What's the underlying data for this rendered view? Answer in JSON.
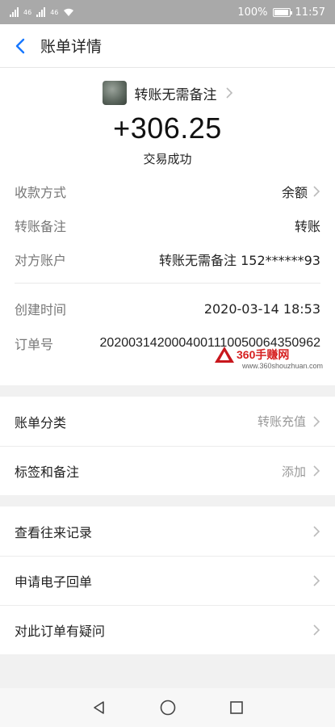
{
  "status": {
    "signal_left": "46",
    "signal_right": "46",
    "battery": "100%",
    "time": "11:57"
  },
  "header": {
    "title": "账单详情"
  },
  "summary": {
    "payee": "转账无需备注",
    "amount": "+306.25",
    "result": "交易成功"
  },
  "details": [
    {
      "label": "收款方式",
      "value": "余额",
      "has_chevron": true
    },
    {
      "label": "转账备注",
      "value": "转账",
      "has_chevron": false
    },
    {
      "label": "对方账户",
      "value": "转账无需备注 152******93",
      "has_chevron": false
    }
  ],
  "details2": [
    {
      "label": "创建时间",
      "value": "2020-03-14 18:53"
    },
    {
      "label": "订单号",
      "value": "2020031420004001110050064350962"
    }
  ],
  "watermark": {
    "text": "360手赚网",
    "url": "www.360shouzhuan.com"
  },
  "menu1": [
    {
      "label": "账单分类",
      "value": "转账充值"
    },
    {
      "label": "标签和备注",
      "value": "添加"
    }
  ],
  "menu2": [
    {
      "label": "查看往来记录"
    },
    {
      "label": "申请电子回单"
    },
    {
      "label": "对此订单有疑问"
    }
  ],
  "icons": {
    "back": "chevron-left-icon",
    "chevron": "chevron-right-icon",
    "nav_back": "triangle-back-icon",
    "nav_home": "circle-home-icon",
    "nav_recent": "square-recent-icon"
  },
  "colors": {
    "accent": "#1677ff",
    "statusbar": "#a9a9a9"
  }
}
